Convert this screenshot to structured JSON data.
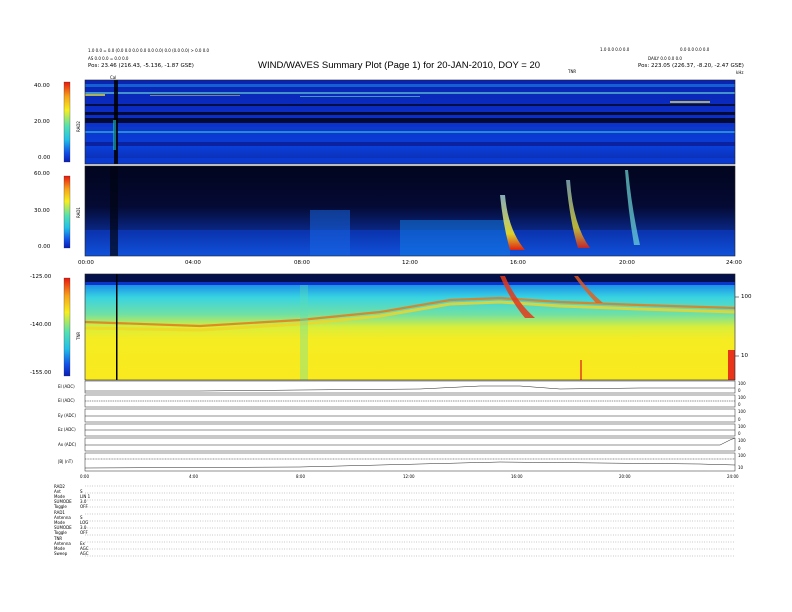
{
  "header": {
    "title": "WIND/WAVES Summary Plot (Page 1) for 20-JAN-2010, DOY = 20",
    "left_line1": "1.0 0.0 = 0.0 (0.0 0.0 0.0 0.0 0.0 0.0) 0.0 (0.0 0.0) > 0.0 0.0",
    "left_line2": "AS 0.0 0.0 = 0.0 0.0",
    "left_line3": "Pos: 23.46 (216.43, -5.136, -1.87 GSE)",
    "right_line1": "1.0 0.0 0.0 0.0",
    "right_line2": "0.0 0.0 0.0 0.0",
    "right_line3": "DAILY 0.0 0.0 0.0",
    "right_line4": "Pos: 223.05 (226.37, -8.20, -2.47 GSE)",
    "tnr_marker": "TNR",
    "cal_marker": "Cal",
    "rad2_marker": "kHz"
  },
  "panels": {
    "rad2": {
      "ylabel": "RAD2",
      "yticks": [
        "40.00",
        "20.00",
        "0.00"
      ]
    },
    "rad1": {
      "ylabel": "RAD1",
      "yticks": [
        "60.00",
        "30.00",
        "0.00"
      ]
    },
    "tnr": {
      "ylabel": "TNR",
      "yticks": [
        "-125.00",
        "-140.00",
        "-155.00"
      ],
      "right_ticks": [
        "100",
        "10"
      ],
      "right_label": ""
    }
  },
  "time_axis": {
    "labels": [
      "00:00",
      "04:00",
      "08:00",
      "12:00",
      "16:00",
      "20:00",
      "24:00"
    ],
    "lower_labels": [
      "0:00",
      "4:00",
      "8:00",
      "12:00",
      "16:00",
      "20:00",
      "24:00"
    ]
  },
  "strips": [
    {
      "label": "EI (ADC)",
      "right": [
        "100",
        "0"
      ]
    },
    {
      "label": "EI (ADC)",
      "right": [
        "100",
        "0"
      ]
    },
    {
      "label": "Ey (ADC)",
      "right": [
        "100",
        "0"
      ]
    },
    {
      "label": "Ez (ADC)",
      "right": [
        "100",
        "0"
      ]
    },
    {
      "label": "Ax (ADC)",
      "right": [
        "100",
        "0"
      ]
    },
    {
      "label": "|B| (nT)",
      "right": [
        "100",
        "10"
      ]
    }
  ],
  "footer": {
    "rows": [
      "RAD2",
      "Ant",
      "Mode",
      "SUMODE",
      "Toggle",
      "RAD1",
      "Antenna",
      "Mode",
      "SUMODE",
      "Toggle",
      "TNR",
      "Antenna",
      "Mode",
      "Sweep"
    ],
    "values": [
      "",
      "S",
      "LIN 1",
      "3.0",
      "OFF",
      "",
      "S",
      "LOG",
      "3.0",
      "OFF",
      "",
      "Ex",
      "AGC",
      "AGC"
    ]
  },
  "colors": {
    "colorbar_top": "#e81a12",
    "colorbar_mid_hi": "#f6e31b",
    "colorbar_mid": "#2fd1c8",
    "colorbar_low": "#0a24c9",
    "background_dark": "#050a3a",
    "tnr_yellow": "#f7ee22",
    "tnr_cyan": "#37d4de"
  },
  "chart_data": {
    "type": "heatmap",
    "title": "WIND/WAVES Summary Plot (Page 1) for 20-JAN-2010, DOY = 20",
    "x": [
      "00:00",
      "04:00",
      "08:00",
      "12:00",
      "16:00",
      "20:00",
      "24:00"
    ],
    "series": [
      {
        "name": "RAD2",
        "ylim": [
          0,
          40
        ]
      },
      {
        "name": "RAD1",
        "ylim": [
          0,
          60
        ]
      },
      {
        "name": "TNR",
        "ylim": [
          -155,
          -125
        ]
      }
    ]
  }
}
